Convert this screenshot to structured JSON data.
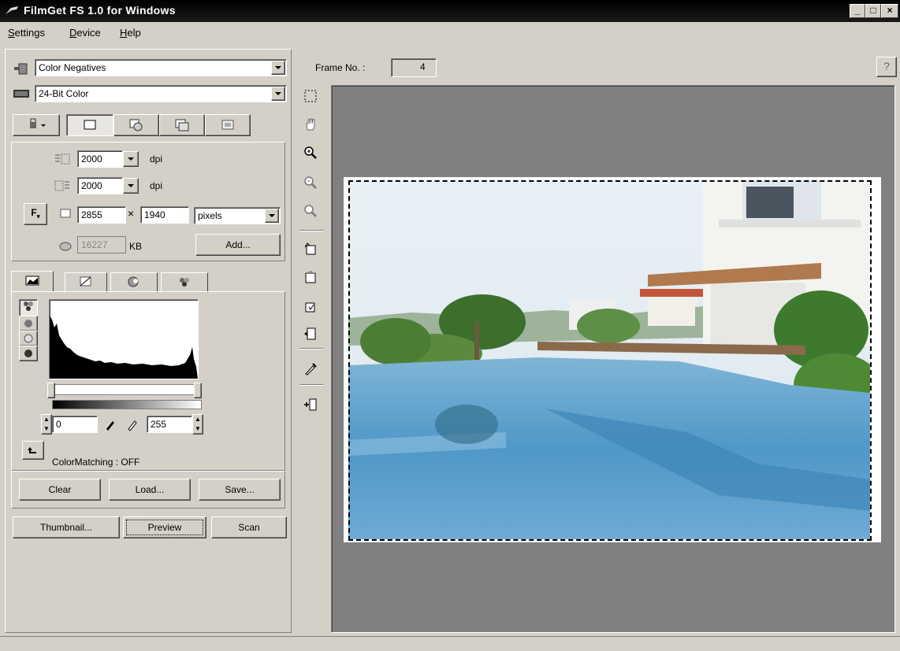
{
  "window": {
    "title": "FilmGet FS 1.0 for Windows",
    "minimize": "_",
    "maximize": "□",
    "close": "×"
  },
  "menu": [
    {
      "label": "Settings",
      "accel": "S",
      "rest": "ettings"
    },
    {
      "label": "Device",
      "accel": "D",
      "rest": "evice"
    },
    {
      "label": "Help",
      "accel": "H",
      "rest": "elp"
    }
  ],
  "source_select": {
    "value": "Color Negatives"
  },
  "color_select": {
    "value": "24-Bit Color"
  },
  "resolution": {
    "input_dpi": "2000",
    "output_dpi": "2000",
    "dpi_unit": "dpi",
    "width": "2855",
    "times": "×",
    "height": "1940",
    "size_unit": "pixels",
    "filesize": "16227",
    "filesize_unit": "KB",
    "add_label": "Add...",
    "f_label": "F"
  },
  "levels": {
    "min": "0",
    "max": "255",
    "colormatching": "ColorMatching : OFF"
  },
  "buttons": {
    "clear": "Clear",
    "load": "Load...",
    "save": "Save...",
    "thumbnail": "Thumbnail...",
    "preview": "Preview",
    "scan": "Scan"
  },
  "frame": {
    "label": "Frame No. :",
    "value": "4"
  },
  "help_icon": "?",
  "tools": [
    "marquee-icon",
    "hand-icon",
    "zoom-in-icon",
    "zoom-out-icon",
    "zoom-fit-icon",
    "rotate-left-icon",
    "flip-icon",
    "rotate-right-icon",
    "mirror-icon",
    "eyedropper-icon",
    "insert-icon"
  ]
}
